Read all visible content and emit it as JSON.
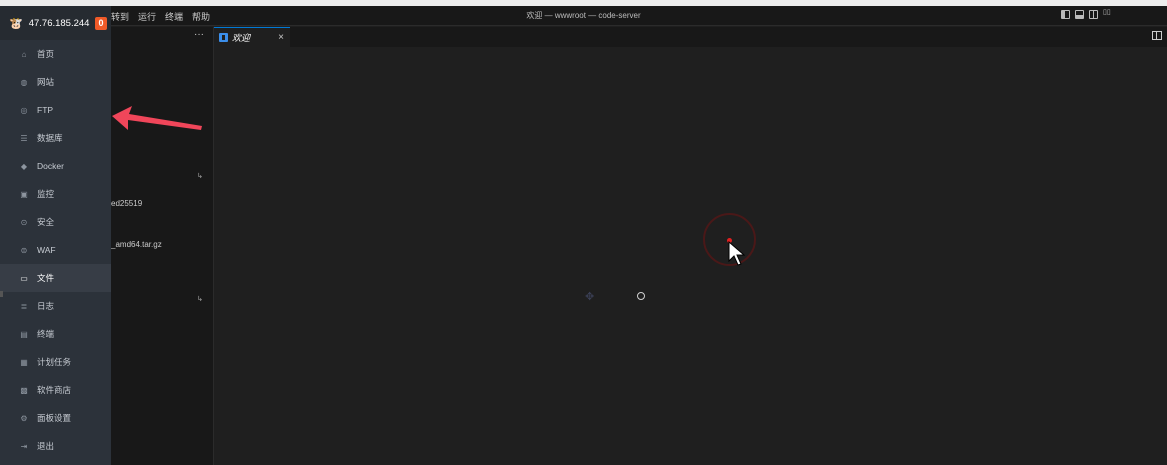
{
  "titlebar": {
    "menu": [
      "转到",
      "运行",
      "终端",
      "帮助"
    ],
    "title": "欢迎 — wwwroot — code-server"
  },
  "explorer": {
    "more": "···",
    "files": [
      "ed25519",
      "_amd64.tar.gz"
    ]
  },
  "tabs": [
    {
      "label": "欢迎",
      "close": "×"
    }
  ],
  "sidebar": {
    "ip": "47.76.185.244",
    "badge": "0",
    "items": [
      {
        "label": "首页",
        "icon": "home-icon"
      },
      {
        "label": "网站",
        "icon": "globe-icon"
      },
      {
        "label": "FTP",
        "icon": "ftp-icon"
      },
      {
        "label": "数据库",
        "icon": "database-icon"
      },
      {
        "label": "Docker",
        "icon": "docker-icon"
      },
      {
        "label": "监控",
        "icon": "monitor-icon"
      },
      {
        "label": "安全",
        "icon": "shield-icon"
      },
      {
        "label": "WAF",
        "icon": "waf-icon"
      },
      {
        "label": "文件",
        "icon": "folder-icon",
        "active": true
      },
      {
        "label": "日志",
        "icon": "log-icon"
      },
      {
        "label": "终端",
        "icon": "terminal-icon"
      },
      {
        "label": "计划任务",
        "icon": "calendar-icon"
      },
      {
        "label": "软件商店",
        "icon": "grid-icon"
      },
      {
        "label": "面板设置",
        "icon": "settings-icon"
      },
      {
        "label": "退出",
        "icon": "logout-icon"
      }
    ]
  },
  "colors": {
    "sidebar_bg": "#2c323a",
    "badge": "#f05a28",
    "annotation_arrow": "#f0465a",
    "tab_accent": "#0078d4"
  }
}
